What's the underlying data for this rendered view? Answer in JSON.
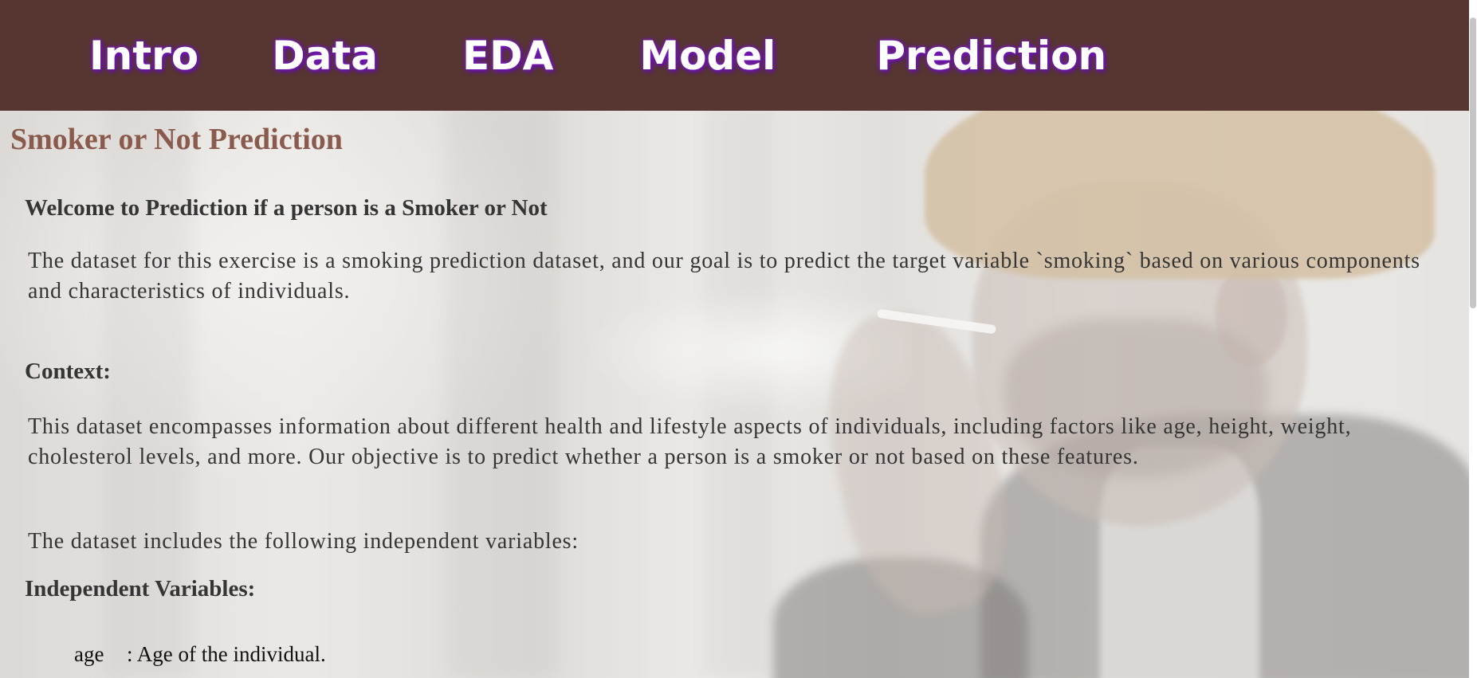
{
  "nav": {
    "items": [
      "Intro",
      "Data",
      "EDA",
      "Model",
      "Prediction"
    ]
  },
  "page": {
    "title": "Smoker or Not Prediction",
    "welcome_heading": "Welcome to Prediction if a person is a Smoker or Not",
    "intro_paragraph": "The dataset for this exercise is a smoking prediction dataset, and our goal is to predict the target variable `smoking` based on various components and characteristics of individuals.",
    "context_heading": "Context:",
    "context_paragraph": "This dataset encompasses information about different health and lifestyle aspects of individuals, including factors like age, height, weight, cholesterol levels, and more. Our objective is to predict whether a person is a smoker or not based on these features.",
    "variables_intro": "The dataset includes the following independent variables:",
    "variables_heading": "Independent Variables:",
    "variables": [
      {
        "name": "age",
        "description": ": Age of the individual."
      }
    ]
  },
  "colors": {
    "navbar_bg": "#573631",
    "nav_text": "#ffffff",
    "nav_glow": "#7a17c9",
    "title": "#8a5a4c",
    "body_text": "#353535"
  }
}
